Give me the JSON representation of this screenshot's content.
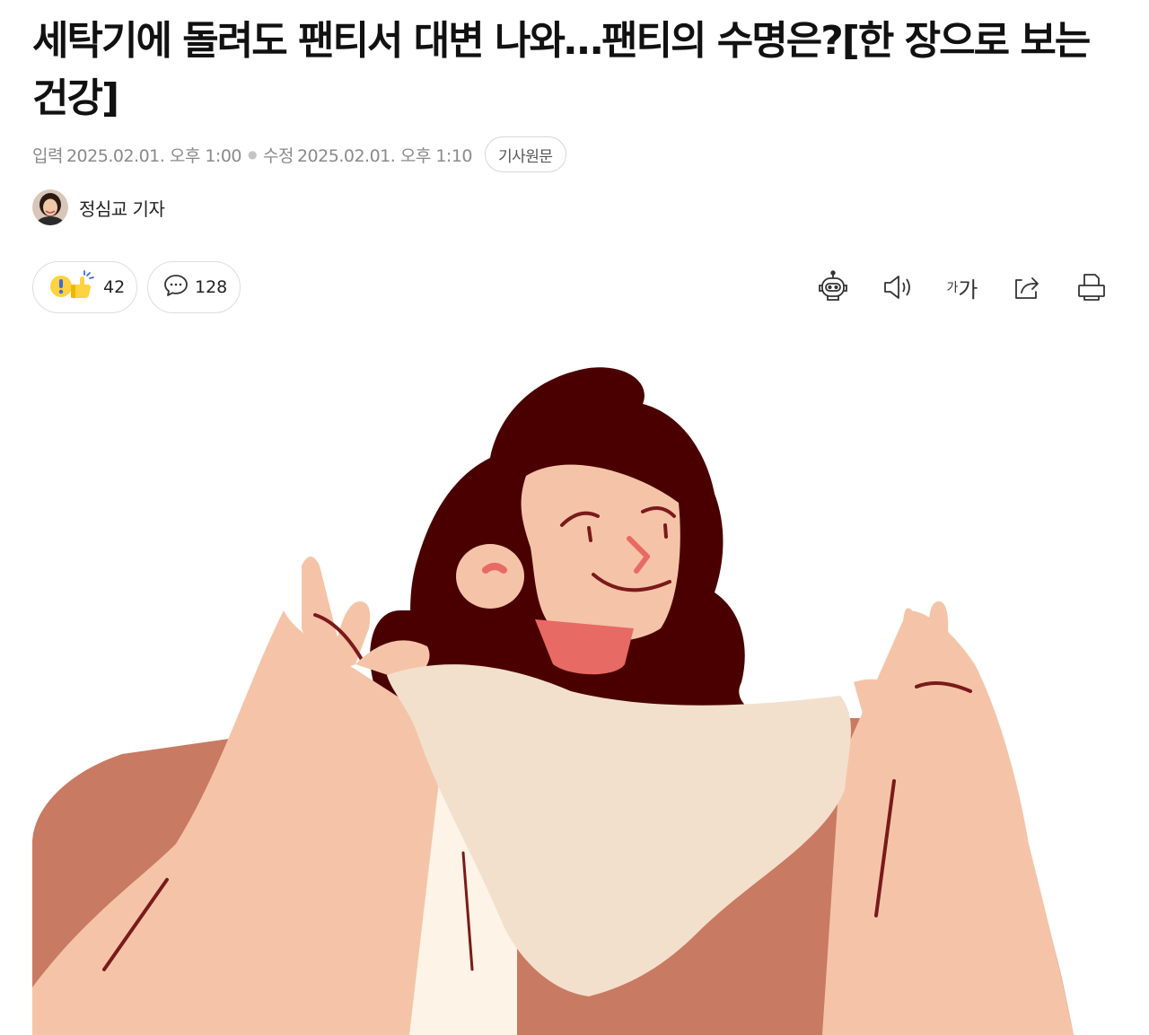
{
  "article": {
    "headline": "세탁기에 돌려도 팬티서 대변 나와…팬티의 수명은?[한 장으로 보는 건강]",
    "published_label": "입력",
    "published": "2025.02.01. 오후 1:00",
    "modified_label": "수정",
    "modified": "2025.02.01. 오후 1:10",
    "original_button": "기사원문",
    "reporter": "정심교 기자"
  },
  "reactions": {
    "count": "42",
    "icon": "surprise-thumbs-up-icon"
  },
  "comments": {
    "count": "128",
    "icon": "speech-bubble-icon"
  },
  "toolbar": {
    "icons": [
      "robot-summary-icon",
      "speaker-icon",
      "font-size-icon",
      "share-icon",
      "print-icon"
    ],
    "font_size_label_small": "가",
    "font_size_label_large": "가"
  },
  "hero_image": {
    "alt": "woman holding underwear illustration"
  },
  "colors": {
    "hair": "#4b0000",
    "skin": "#f5c4a8",
    "jacket": "#c97a62",
    "cloth": "#f2e0cd",
    "lips": "#e86a64",
    "dark_line": "#7a1a1a"
  }
}
